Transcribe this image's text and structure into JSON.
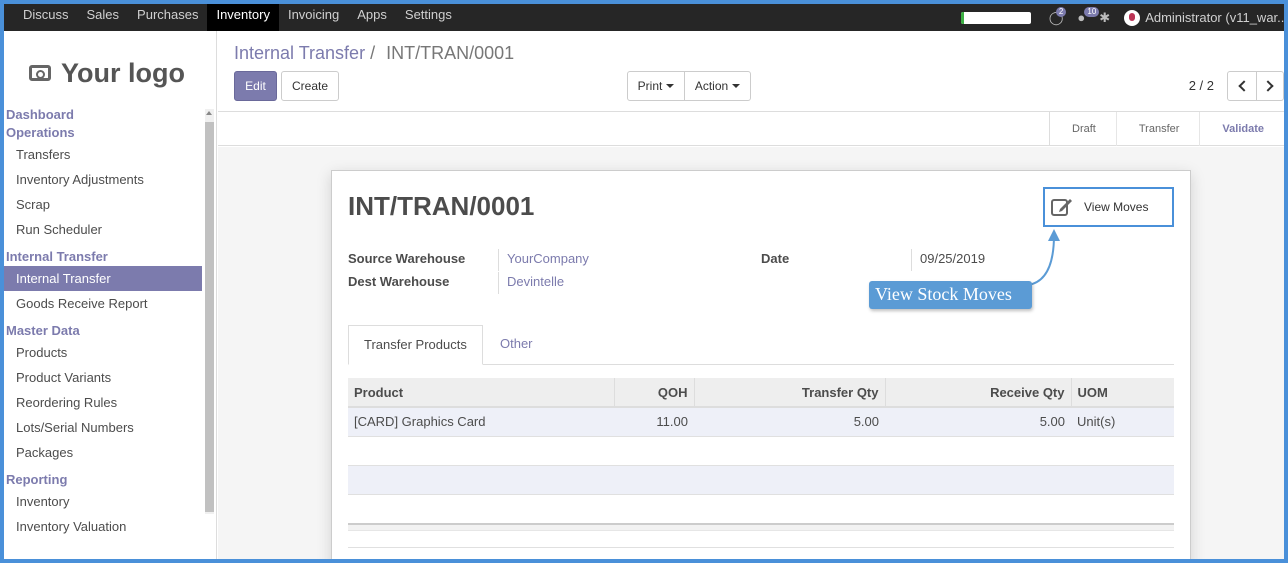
{
  "topnav": {
    "menus": [
      "Discuss",
      "Sales",
      "Purchases",
      "Inventory",
      "Invoicing",
      "Apps",
      "Settings"
    ],
    "active": "Inventory",
    "progress_percent": 5,
    "chat_badge": "2",
    "messages_badge": "10",
    "user": "Administrator (v11_war..."
  },
  "sidebar": {
    "logo_text": "Your logo",
    "sections": [
      {
        "title": "Dashboard",
        "items": []
      },
      {
        "title": "Operations",
        "items": [
          "Transfers",
          "Inventory Adjustments",
          "Scrap",
          "Run Scheduler"
        ]
      },
      {
        "title": "Internal Transfer",
        "items": [
          "Internal Transfer",
          "Goods Receive Report"
        ]
      },
      {
        "title": "Master Data",
        "items": [
          "Products",
          "Product Variants",
          "Reordering Rules",
          "Lots/Serial Numbers",
          "Packages"
        ]
      },
      {
        "title": "Reporting",
        "items": [
          "Inventory",
          "Inventory Valuation"
        ]
      }
    ],
    "active_item": "Internal Transfer"
  },
  "control": {
    "breadcrumb_parent": "Internal Transfer",
    "breadcrumb_sep": "/",
    "breadcrumb_current": "INT/TRAN/0001",
    "edit_label": "Edit",
    "create_label": "Create",
    "print_label": "Print",
    "action_label": "Action",
    "pager": "2 / 2"
  },
  "status": {
    "stages": [
      "Draft",
      "Transfer",
      "Validate"
    ],
    "active": "Validate"
  },
  "form": {
    "title": "INT/TRAN/0001",
    "smart_button": "View Moves",
    "callout": "View Stock Moves",
    "source_label": "Source Warehouse",
    "source_value": "YourCompany",
    "dest_label": "Dest Warehouse",
    "dest_value": "Devintelle",
    "date_label": "Date",
    "date_value": "09/25/2019",
    "tabs": [
      "Transfer Products",
      "Other"
    ],
    "columns": [
      "Product",
      "QOH",
      "Transfer Qty",
      "Receive Qty",
      "UOM"
    ],
    "rows": [
      {
        "product": "[CARD] Graphics Card",
        "qoh": "11.00",
        "transfer_qty": "5.00",
        "receive_qty": "5.00",
        "uom": "Unit(s)"
      }
    ]
  }
}
